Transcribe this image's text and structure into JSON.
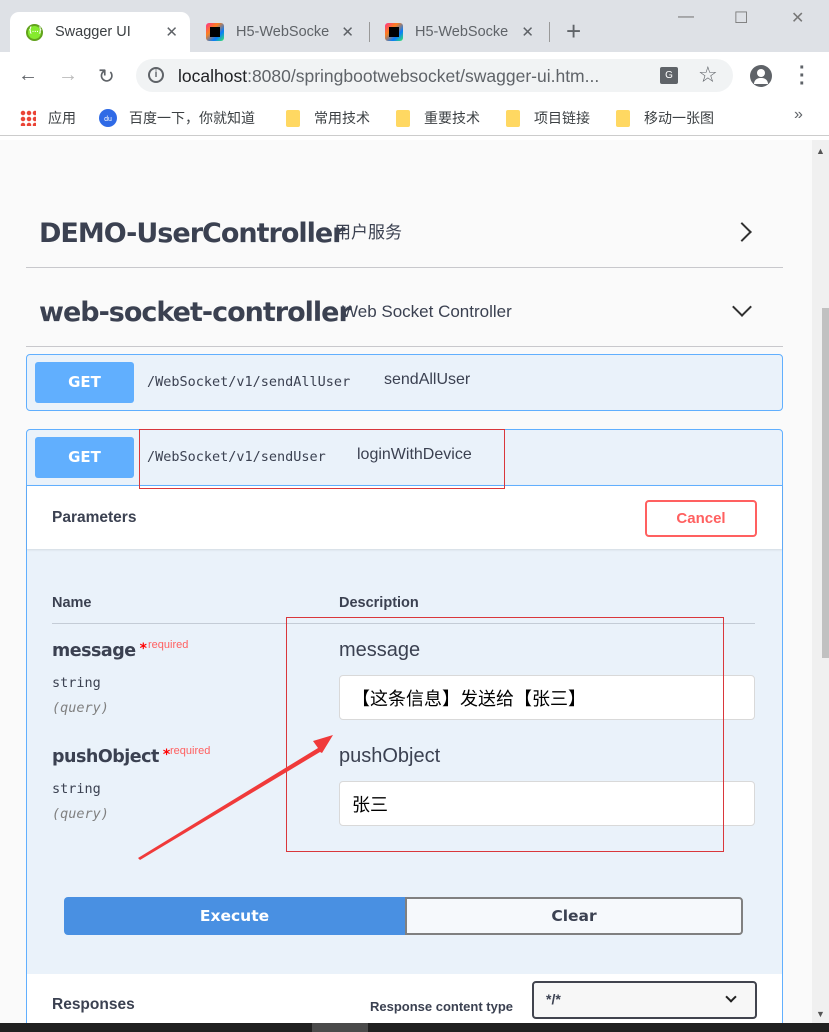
{
  "browser": {
    "tabs": [
      {
        "title": "Swagger UI",
        "icon": "swagger-icon",
        "active": true
      },
      {
        "title": "H5-WebSocke",
        "icon": "jetbrains-icon",
        "active": false
      },
      {
        "title": "H5-WebSocke",
        "icon": "jetbrains-icon",
        "active": false
      }
    ],
    "new_tab_label": "+",
    "close_glyph": "✕",
    "window_controls": {
      "minimize": "—",
      "maximize": "☐",
      "close": "✕"
    },
    "nav": {
      "back": "←",
      "forward": "→",
      "reload": "↻"
    },
    "url_host": "localhost",
    "url_rest": ":8080/springbootwebsocket/swagger-ui.htm...",
    "translate_glyph": "G",
    "star_glyph": "☆",
    "menu_glyph": "⋮",
    "bookmarks": [
      {
        "label": "应用",
        "icon": "apps-icon"
      },
      {
        "label": "百度一下，你就知道",
        "icon": "baidu-icon"
      },
      {
        "label": "常用技术",
        "icon": "folder-icon"
      },
      {
        "label": "重要技术",
        "icon": "folder-icon"
      },
      {
        "label": "项目链接",
        "icon": "folder-icon"
      },
      {
        "label": "移动一张图",
        "icon": "folder-icon"
      }
    ],
    "bookmarks_more": "»"
  },
  "swagger": {
    "tags": [
      {
        "name": "DEMO-UserController",
        "description": "用户服务",
        "expanded": false
      },
      {
        "name": "web-socket-controller",
        "description": "Web Socket Controller",
        "expanded": true
      }
    ],
    "operations": [
      {
        "method": "GET",
        "path": "/WebSocket/v1/sendAllUser",
        "summary": "sendAllUser"
      },
      {
        "method": "GET",
        "path": "/WebSocket/v1/sendUser",
        "summary": "loginWithDevice"
      }
    ],
    "parameters_section": {
      "title": "Parameters",
      "cancel_label": "Cancel",
      "col_name": "Name",
      "col_description": "Description",
      "params": [
        {
          "name": "message",
          "required_star": "*",
          "required_label": "required",
          "type": "string",
          "in": "(query)",
          "description": "message",
          "value": "【这条信息】发送给【张三】"
        },
        {
          "name": "pushObject",
          "required_star": "*",
          "required_label": "required",
          "type": "string",
          "in": "(query)",
          "description": "pushObject",
          "value": "张三"
        }
      ],
      "execute_label": "Execute",
      "clear_label": "Clear"
    },
    "responses": {
      "title": "Responses",
      "content_type_label": "Response content type",
      "content_type_value": "*/*"
    }
  },
  "colors": {
    "get_method": "#61affe",
    "execute": "#4990e2",
    "cancel": "#ff6060",
    "annotation": "#d9373b"
  }
}
